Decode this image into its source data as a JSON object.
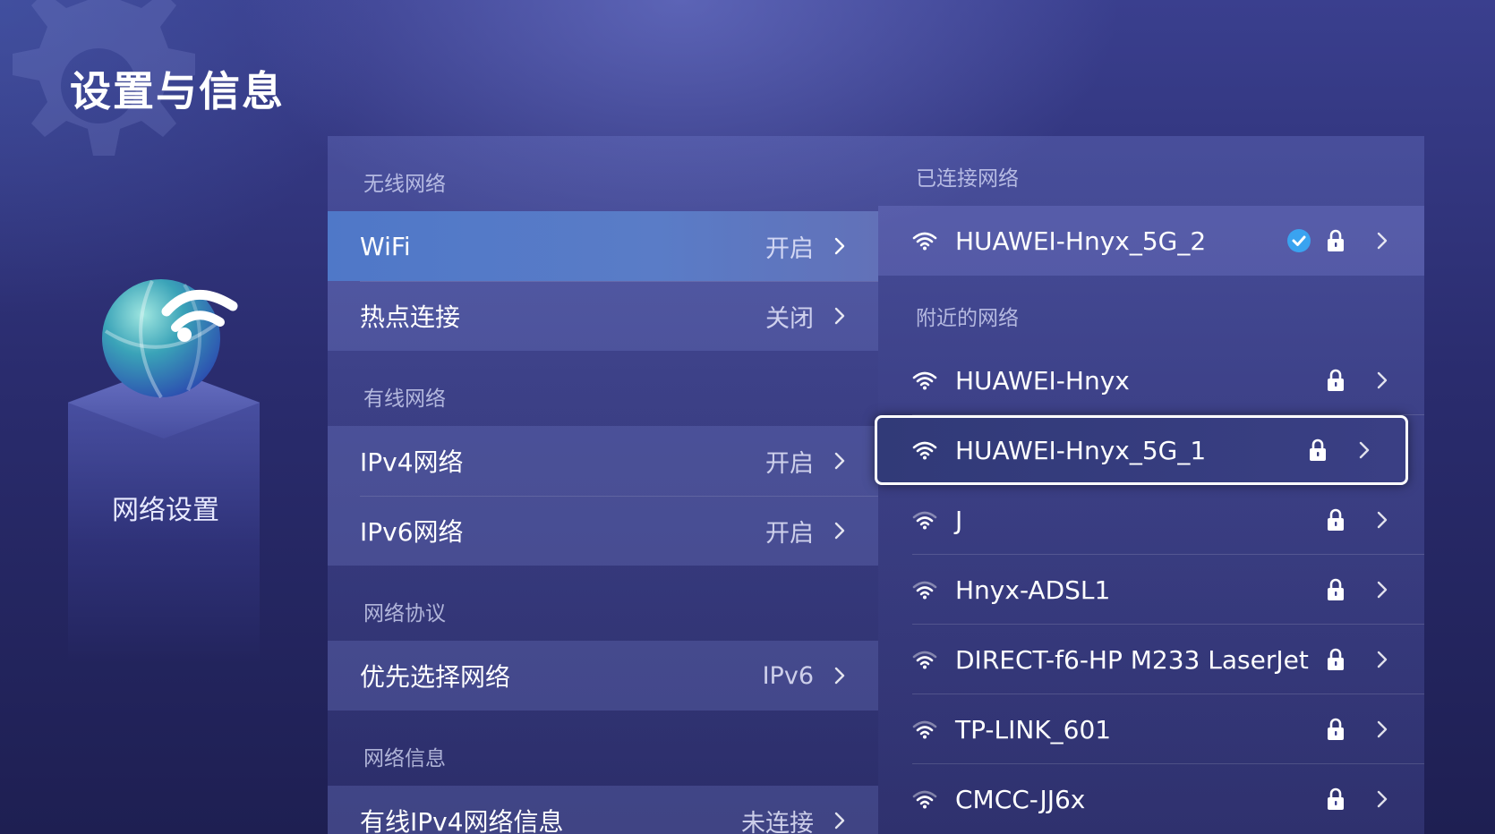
{
  "page": {
    "title": "设置与信息"
  },
  "category": {
    "label": "网络设置",
    "icon": "globe-wifi-icon"
  },
  "settings": {
    "sections": [
      {
        "header": "无线网络",
        "rows": [
          {
            "label": "WiFi",
            "value": "开启",
            "selected": true
          },
          {
            "label": "热点连接",
            "value": "关闭"
          }
        ]
      },
      {
        "header": "有线网络",
        "rows": [
          {
            "label": "IPv4网络",
            "value": "开启"
          },
          {
            "label": "IPv6网络",
            "value": "开启"
          }
        ]
      },
      {
        "header": "网络协议",
        "rows": [
          {
            "label": "优先选择网络",
            "value": "IPv6"
          }
        ]
      },
      {
        "header": "网络信息",
        "rows": [
          {
            "label": "有线IPv4网络信息",
            "value": "未连接"
          }
        ]
      }
    ]
  },
  "networks": {
    "connected_header": "已连接网络",
    "connected": {
      "name": "HUAWEI-Hnyx_5G_2",
      "signal": "strong",
      "secured": true,
      "connected": true
    },
    "nearby_header": "附近的网络",
    "nearby": [
      {
        "name": "HUAWEI-Hnyx",
        "signal": "strong",
        "secured": true
      },
      {
        "name": "HUAWEI-Hnyx_5G_1",
        "signal": "strong",
        "secured": true,
        "focused": true
      },
      {
        "name": "J",
        "signal": "medium",
        "secured": true
      },
      {
        "name": "Hnyx-ADSL1",
        "signal": "medium",
        "secured": true
      },
      {
        "name": "DIRECT-f6-HP M233 LaserJet",
        "signal": "medium",
        "secured": true
      },
      {
        "name": "TP-LINK_601",
        "signal": "medium",
        "secured": true
      },
      {
        "name": "CMCC-JJ6x",
        "signal": "medium",
        "secured": true
      }
    ]
  },
  "colors": {
    "selected_row": "#5a7cc7",
    "check_badge": "#3aa3f0",
    "background": "#2a2c6e"
  }
}
